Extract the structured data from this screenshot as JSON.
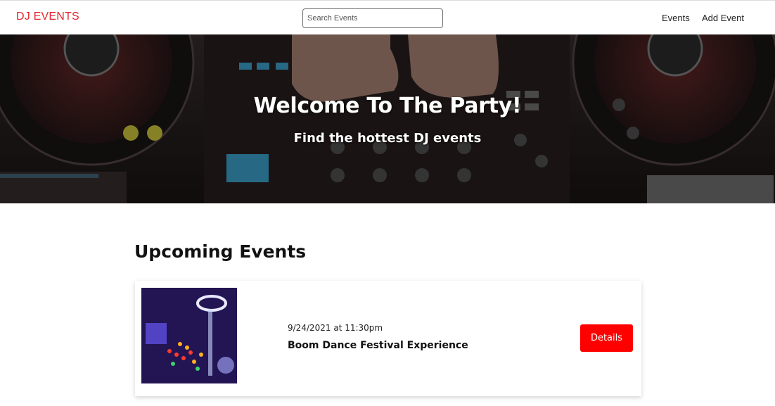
{
  "header": {
    "logo": "DJ EVENTS",
    "search_placeholder": "Search Events",
    "nav": {
      "events": "Events",
      "add_event": "Add Event"
    }
  },
  "hero": {
    "title": "Welcome To The Party!",
    "subtitle": "Find the hottest DJ events"
  },
  "main": {
    "section_title": "Upcoming Events",
    "events": [
      {
        "date": "9/24/2021 at 11:30pm",
        "name": "Boom Dance Festival Experience",
        "button": "Details"
      }
    ]
  },
  "colors": {
    "brand": "#e0262b",
    "button": "#ff0000"
  }
}
